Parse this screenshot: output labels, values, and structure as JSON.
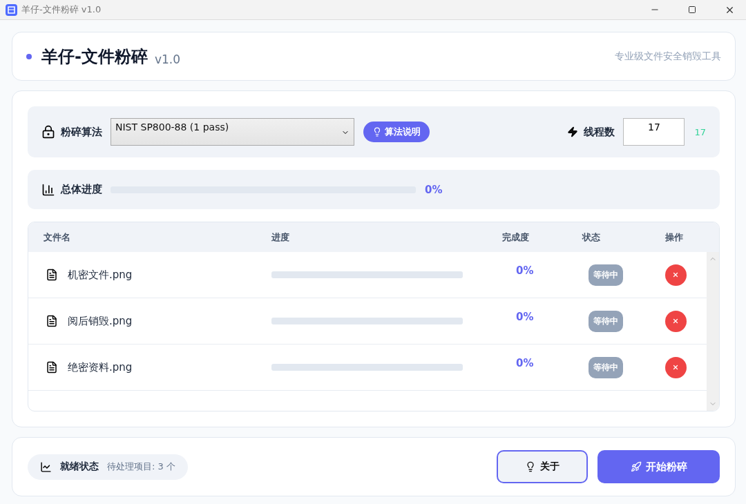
{
  "window": {
    "title": "羊仔-文件粉碎 v1.0"
  },
  "header": {
    "title": "羊仔-文件粉碎",
    "version": "v1.0",
    "subtitle": "专业级文件安全销毁工具"
  },
  "settings": {
    "algorithm_label": "粉碎算法",
    "algorithm": "NIST SP800-88 (1 pass)",
    "explain_button": "算法说明",
    "threads_label": "线程数",
    "threads_value": "17",
    "threads_reading": "17"
  },
  "overall": {
    "label": "总体进度",
    "level": 0,
    "reading": "0%"
  },
  "table": {
    "columns": [
      "文件名",
      "进度",
      "完成度",
      "状态",
      "操作"
    ],
    "rows": [
      {
        "name": "机密文件.png",
        "level": 0,
        "percent": "0%",
        "status": "等待中"
      },
      {
        "name": "阅后销毁.png",
        "level": 0,
        "percent": "0%",
        "status": "等待中"
      },
      {
        "name": "绝密资料.png",
        "level": 0,
        "percent": "0%",
        "status": "等待中"
      }
    ]
  },
  "footer": {
    "status": "就绪状态",
    "pending": "待处理项目: 3 个",
    "about_button": "关于",
    "start_button": "开始粉碎"
  }
}
